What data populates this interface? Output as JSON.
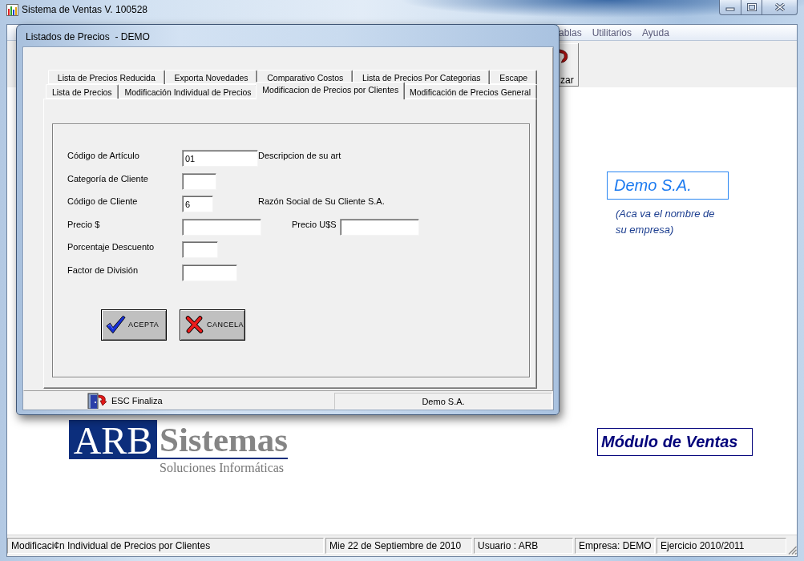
{
  "window": {
    "title": "Sistema de Ventas V. 100528",
    "caption_buttons": [
      {
        "kind": "minimize"
      },
      {
        "kind": "maximize"
      },
      {
        "kind": "close"
      }
    ]
  },
  "menu": [
    {
      "label": "ablas"
    },
    {
      "label": "Utilitarios"
    },
    {
      "label": "Ayuda"
    }
  ],
  "toolbar": [
    {
      "label": "zar"
    }
  ],
  "dialog": {
    "title": "Listados de Precios  - DEMO",
    "tab_rows": [
      [
        {
          "label": "Lista de Precios Reducida",
          "selected": false
        },
        {
          "label": "Exporta Novedades",
          "selected": false
        },
        {
          "label": "Comparativo Costos",
          "selected": false
        },
        {
          "label": "Lista de Precios Por Categorias",
          "selected": false
        },
        {
          "label": "Escape",
          "selected": false
        }
      ],
      [
        {
          "label": "Lista de Precios",
          "selected": false
        },
        {
          "label": "Modificación Individual de Precios",
          "selected": false
        },
        {
          "label": "Modificacion de Precios por Clientes",
          "selected": true
        },
        {
          "label": "Modificación de Precios General",
          "selected": false
        }
      ]
    ],
    "form": [
      {
        "label": "Código de Artículo",
        "value": "01",
        "note": "Descripcion de su art"
      },
      {
        "label": "Categoría de Cliente"
      },
      {
        "label": "Código de Cliente",
        "value": "6",
        "note": "Razón Social de Su Cliente S.A."
      },
      {
        "label": "Precio $",
        "second_label": "Precio U$S"
      },
      {
        "label": "Porcentaje Descuento"
      },
      {
        "label": "Factor de División"
      }
    ],
    "buttons": [
      {
        "kind": "accept",
        "label": "ACEPTA"
      },
      {
        "kind": "cancel",
        "label": "CANCELA"
      }
    ],
    "footer": {
      "hint": "ESC Finaliza",
      "company": "Demo S.A."
    }
  },
  "logo": {
    "mark": "ARB",
    "name": "Sistemas",
    "tagline": "Soluciones Informáticas"
  },
  "company": {
    "name": "Demo S.A.",
    "note": "(Aca va el nombre de su empresa)"
  },
  "module_title": "Módulo de Ventas",
  "status_bar": [
    "Modificaci¢n Individual de Precios por Clientes",
    "Mie 22 de Septiembre de 2010",
    "Usuario : ARB",
    "Empresa: DEMO",
    "Ejercicio 2010/2011"
  ]
}
